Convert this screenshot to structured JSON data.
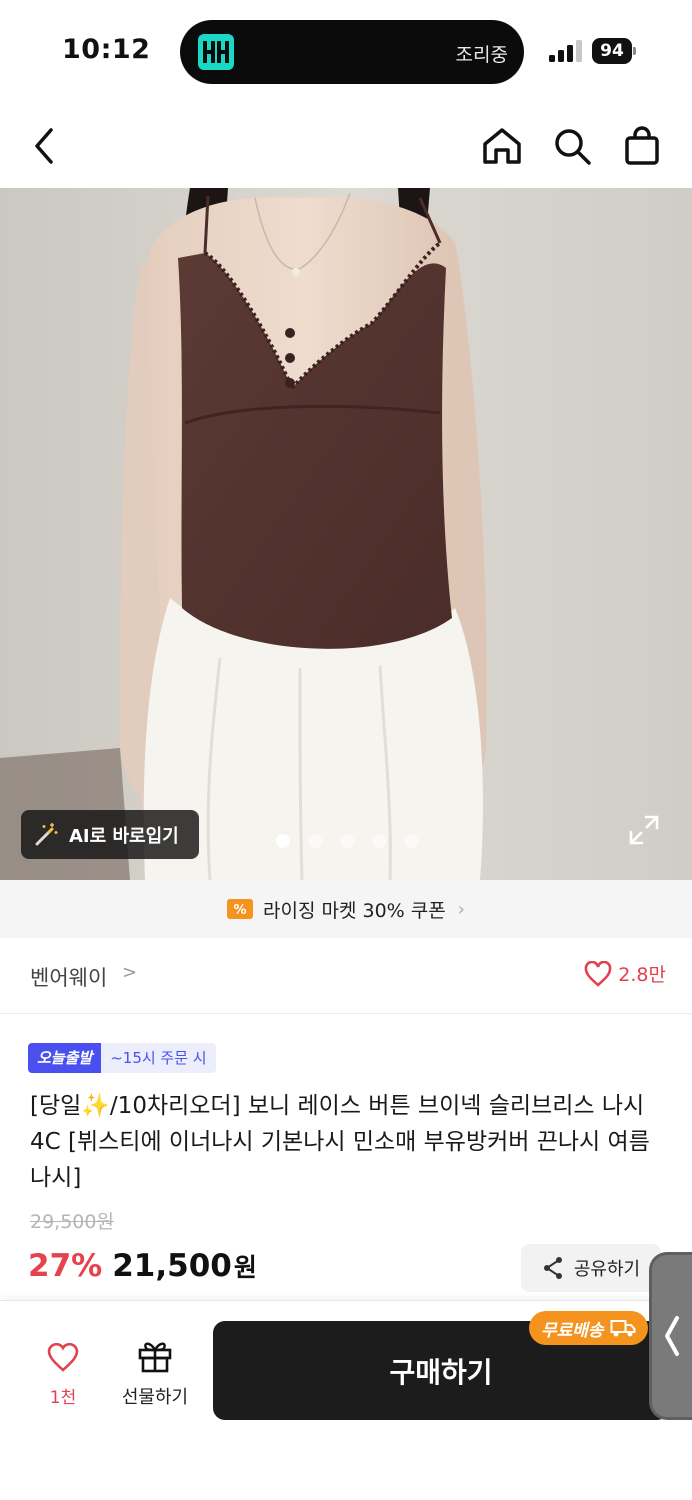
{
  "status_bar": {
    "time": "10:12",
    "island_text": "조리중",
    "battery": "94"
  },
  "nav": {
    "back_icon": "chevron-left-icon",
    "home_icon": "home-icon",
    "search_icon": "search-icon",
    "bag_icon": "shopping-bag-icon"
  },
  "hero": {
    "ai_button_label": "AI로 바로입기",
    "image_count": 5,
    "active_index": 0
  },
  "coupon": {
    "label": "라이징 마켓 30% 쿠폰"
  },
  "brand": {
    "name": "벤어웨이",
    "chevron": ">",
    "likes": "2.8만"
  },
  "product": {
    "badge_today": "오늘출발",
    "badge_time": "~15시 주문 시",
    "title": "[당일✨/10차리오더] 보니 레이스 버튼 브이넥 슬리브리스 나시 4C [뷔스티에 이너나시 기본나시 민소매 부유방커버 끈나시 여름나시]",
    "original_price": "29,500원",
    "discount": "27%",
    "price": "21,500",
    "currency": "원",
    "share_label": "공유하기"
  },
  "bottom_bar": {
    "like_count": "1천",
    "gift_label": "선물하기",
    "buy_label": "구매하기",
    "free_shipping_label": "무료배송"
  },
  "colors": {
    "accent_red": "#e8414e",
    "badge_blue": "#4a50f0",
    "shipping_orange": "#f5931f",
    "buy_button": "#1c1c1c"
  }
}
